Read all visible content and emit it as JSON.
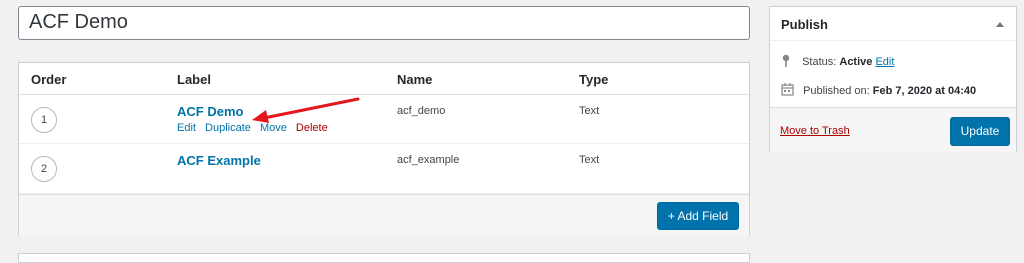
{
  "title_input": {
    "value": "ACF Demo"
  },
  "fields_table": {
    "headers": {
      "order": "Order",
      "label": "Label",
      "name": "Name",
      "type": "Type"
    },
    "rows": [
      {
        "order": "1",
        "label": "ACF Demo",
        "name": "acf_demo",
        "type": "Text",
        "actions": {
          "edit": "Edit",
          "duplicate": "Duplicate",
          "move": "Move",
          "delete": "Delete"
        }
      },
      {
        "order": "2",
        "label": "ACF Example",
        "name": "acf_example",
        "type": "Text"
      }
    ],
    "add_field_label": "+ Add Field"
  },
  "publish": {
    "title": "Publish",
    "status_label": "Status:",
    "status_value": "Active",
    "status_edit": "Edit",
    "published_label": "Published on:",
    "published_value": "Feb 7, 2020 at 04:40",
    "trash_label": "Move to Trash",
    "update_label": "Update"
  },
  "colors": {
    "primary": "#0073aa",
    "danger": "#a00",
    "annotation_arrow": "#e3161b"
  },
  "icons": [
    "pin-icon",
    "calendar-icon",
    "caret-up-icon",
    "arrow-annotation-icon"
  ]
}
